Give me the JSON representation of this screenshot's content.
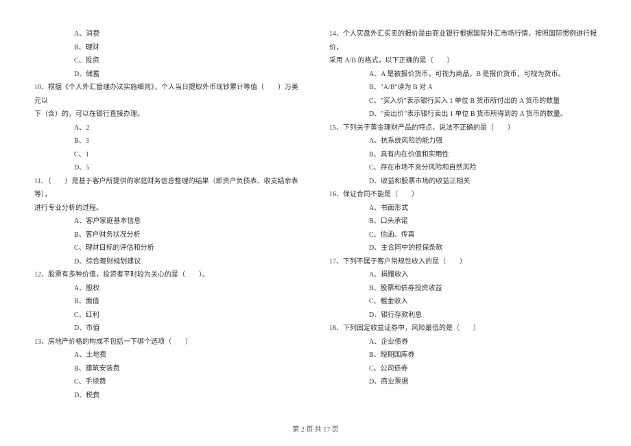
{
  "left": {
    "opts_9": [
      "A、消费",
      "B、理财",
      "C、投资",
      "D、储蓄"
    ],
    "q10_l1": "10、根据《个人外汇管理办法实施细则》，个人当日提取外币现钞累计等值（　　）万美元以",
    "q10_l2": "下（含）的，可以在银行直接办理。",
    "opts_10": [
      "A、2",
      "B、3",
      "C、1",
      "D、5"
    ],
    "q11_l1": "11、（　　）是基于客户所提供的家庭财务信息整理的结果（即资产负债表、收支结余表等），",
    "q11_l2": "进行专业分析的过程。",
    "opts_11": [
      "A、客户家庭基本信息",
      "B、客户财务状况分析",
      "C、理财目标的评估和分析",
      "D、综合理财规划建议"
    ],
    "q12": "12、股票有多种价值，投资者平时较为关心的是（　　）。",
    "opts_12": [
      "A、股权",
      "B、面值",
      "C、红利",
      "D、市值"
    ],
    "q13": "13、房地产价格的构成不包括一下哪个选项（　　）",
    "opts_13": [
      "A、土地费",
      "B、建筑安装费",
      "C、手续费",
      "D、税费"
    ]
  },
  "right": {
    "q14_l1": "14、个人实盘外汇买卖的报价是由商业银行根据国际外汇市场行情，按照国际惯例进行报价，",
    "q14_l2": "采用 A/B 的格式，以下正确的是（　　）",
    "opts_14": [
      "A、A 是被报价货币，可视为商品，B 是报价货币，可视为货币。",
      "B、\"A/B\"读为 B 对 A",
      "C、\"买入价\"表示银行买入 1 单位 B 货币所付出的 A 货币的数量",
      "D、\"卖出价\"表示银行卖出 1 单位 B 货币所得到的 A 货币的数量。"
    ],
    "q15": "15、下列关于黄金理财产品的特点，说法不正确的是（　　）",
    "opts_15": [
      "A、抗系统风险的能力强",
      "B、具有内在价值和实用性",
      "C、存在市场不充分风险和自然风险",
      "D、收益和股票市场的收益正相关"
    ],
    "q16": "16、保证合同不能是（　　）",
    "opts_16": [
      "A、书面形式",
      "B、口头承诺",
      "C、信函、传真",
      "D、主合同中的担保条款"
    ],
    "q17": "17、下列不属于客户常规性收入的是（　　）",
    "opts_17": [
      "A、捐赠收入",
      "B、股票和债券投资收益",
      "C、租金收入",
      "D、银行存款利息"
    ],
    "q18": "18、下列固定收益证券中，风险最低的是（　　）",
    "opts_18": [
      "A、企业债券",
      "B、短期国库券",
      "C、公司债券",
      "D、商业票据"
    ]
  },
  "footer": "第 2 页 共 17 页"
}
